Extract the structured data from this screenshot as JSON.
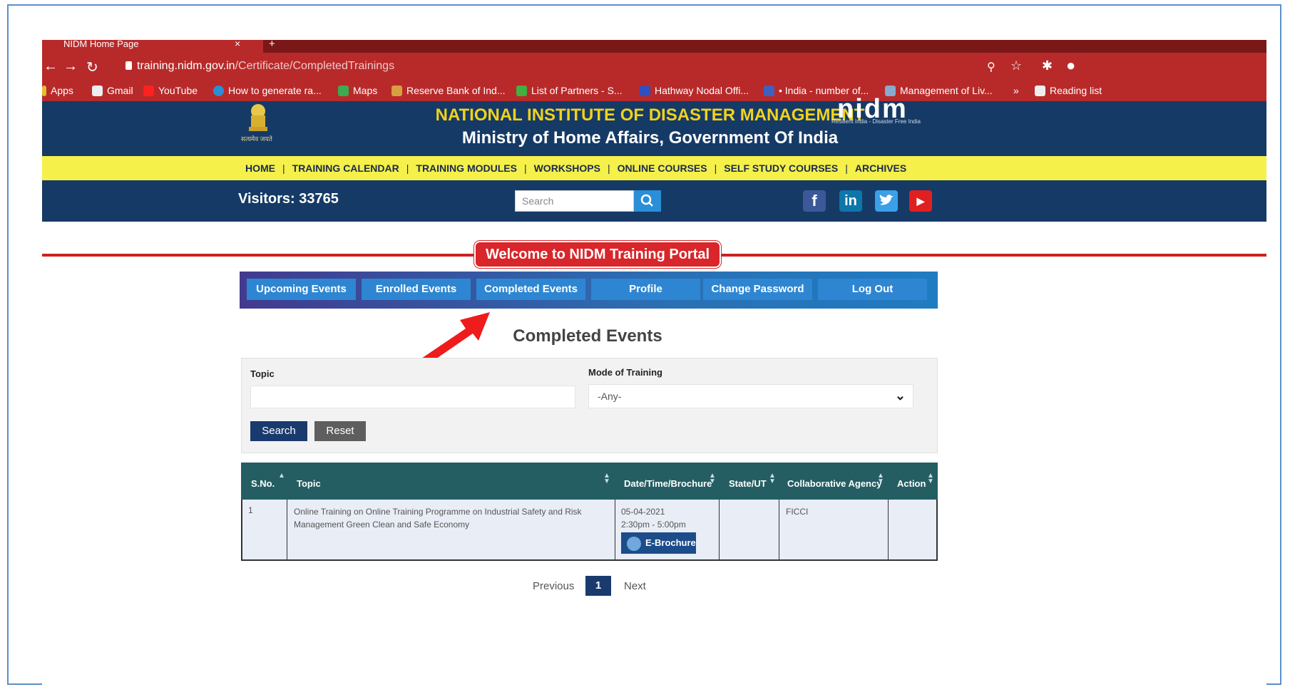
{
  "browser": {
    "tab_title": "NIDM Home Page",
    "url_host": "training.nidm.gov.in",
    "url_path": "/Certificate/CompletedTrainings",
    "bookmarks": [
      "Apps",
      "Gmail",
      "YouTube",
      "How to generate ra...",
      "Maps",
      "Reserve Bank of Ind...",
      "List of Partners - S...",
      "Hathway Nodal Offi...",
      "• India - number of...",
      "Management of Liv...",
      "»",
      "Reading list"
    ]
  },
  "header": {
    "emblem_caption": "सत्यमेव जयते",
    "title": "NATIONAL INSTITUTE OF DISASTER MANAGEMENT",
    "subtitle": "Ministry of Home Affairs, Government Of India",
    "logo_text": "nidm",
    "logo_tagline": "Resilient India - Disaster Free India"
  },
  "menu": {
    "items": [
      "HOME",
      "TRAINING CALENDAR",
      "TRAINING MODULES",
      "WORKSHOPS",
      "ONLINE COURSES",
      "SELF STUDY COURSES",
      "ARCHIVES"
    ],
    "separator": "|"
  },
  "subbar": {
    "visitors": "Visitors: 33765",
    "search_placeholder": "Search"
  },
  "social": {
    "facebook": "f",
    "linkedin": "in",
    "twitter": "t",
    "youtube": "▶"
  },
  "welcome": "Welcome to NIDM Training Portal",
  "tabs": [
    "Upcoming Events",
    "Enrolled Events",
    "Completed Events",
    "Profile",
    "Change Password",
    "Log Out"
  ],
  "page_title": "Completed Events",
  "filter": {
    "topic_label": "Topic",
    "topic_value": "",
    "mode_label": "Mode of Training",
    "mode_value": "-Any-",
    "search_label": "Search",
    "reset_label": "Reset"
  },
  "table": {
    "headers": [
      "S.No.",
      "Topic",
      "Date/Time/Brochure",
      "State/UT",
      "Collaborative Agency",
      "Action"
    ],
    "rows": [
      {
        "sno": "1",
        "topic": "Online Training on Online Training Programme on Industrial Safety and Risk Management Green Clean and Safe Economy",
        "date": "05-04-2021",
        "time": "2:30pm - 5:00pm",
        "brochure": "E-Brochure",
        "state": "",
        "agency": "FICCI",
        "action": ""
      }
    ]
  },
  "pager": {
    "previous": "Previous",
    "current": "1",
    "next": "Next"
  },
  "colors": {
    "header_blue": "#163a66",
    "menu_yellow": "#f5f04a",
    "title_gold": "#f2d21b",
    "accent_red": "#d8262a",
    "table_header": "#245e63"
  }
}
